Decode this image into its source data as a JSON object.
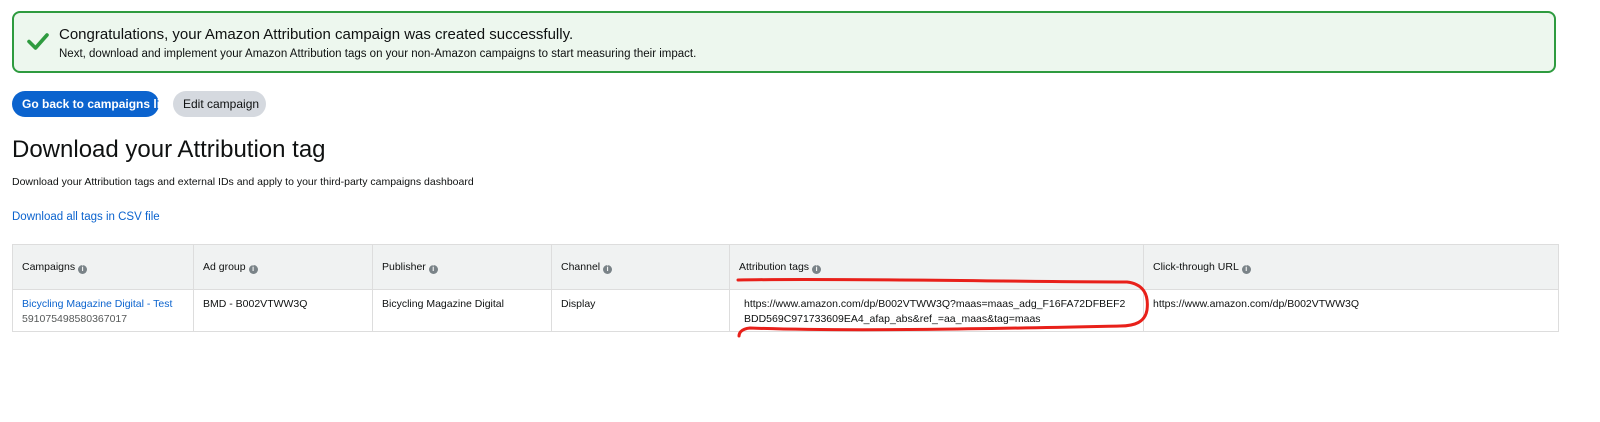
{
  "banner": {
    "title": "Congratulations, your Amazon Attribution campaign was created successfully.",
    "subtitle": "Next, download and implement your Amazon Attribution tags on your non-Amazon campaigns to start measuring their impact.",
    "icon": "check-icon",
    "accent": "#2e9b3f"
  },
  "actions": {
    "back_label": "Go back to campaigns list",
    "edit_label": "Edit campaign"
  },
  "section": {
    "title": "Download your Attribution tag",
    "description": "Download your Attribution tags and external IDs and apply to your third-party campaigns dashboard",
    "csv_link": "Download all tags in CSV file"
  },
  "table": {
    "columns": [
      {
        "label": "Campaigns"
      },
      {
        "label": "Ad group"
      },
      {
        "label": "Publisher"
      },
      {
        "label": "Channel"
      },
      {
        "label": "Attribution tags"
      },
      {
        "label": "Click-through URL"
      }
    ],
    "rows": [
      {
        "campaign_name": "Bicycling Magazine Digital - Test",
        "campaign_id": "591075498580367017",
        "ad_group": "BMD - B002VTWW3Q",
        "publisher": "Bicycling Magazine Digital",
        "channel": "Display",
        "attribution_tag": "https://www.amazon.com/dp/B002VTWW3Q?maas=maas_adg_F16FA72DFBEF2BDD569C971733609EA4_afap_abs&ref_=aa_maas&tag=maas",
        "click_through_url": "https://www.amazon.com/dp/B002VTWW3Q"
      }
    ]
  },
  "colors": {
    "primary": "#0b63ce",
    "success": "#2e9b3f",
    "annotation": "#e8201a"
  }
}
